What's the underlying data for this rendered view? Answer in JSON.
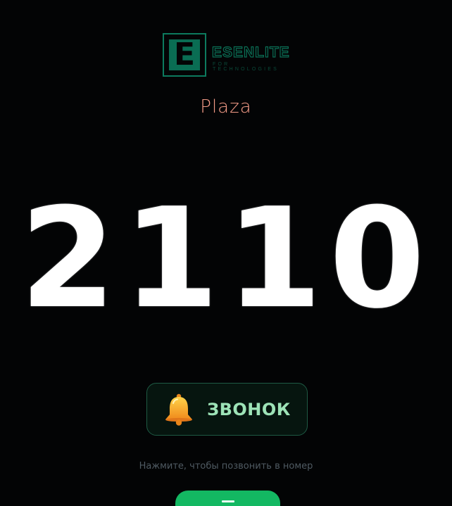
{
  "logo": {
    "letter": "E",
    "wordmark": "ESENLITE",
    "tagline": "FOR TECHNOLOGIES"
  },
  "location": {
    "name": "Plaza"
  },
  "room": {
    "number": "2110"
  },
  "call": {
    "icon": "bell-icon",
    "label": "ЗВОНОК",
    "hint": "Нажмите, чтобы позвонить в номер"
  },
  "colors": {
    "background": "#030405",
    "brand": "#0a6d53",
    "location_text": "#f29a86",
    "call_text": "#9de3b7",
    "action_green": "#13b862"
  }
}
